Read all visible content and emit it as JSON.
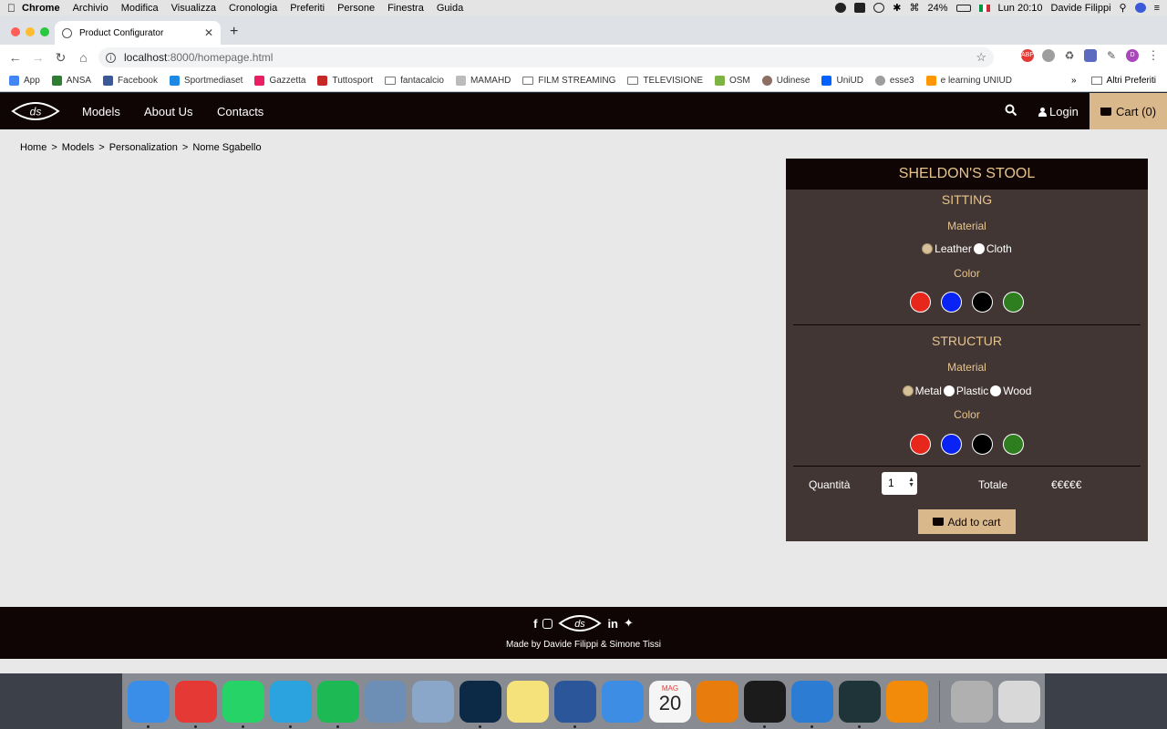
{
  "menubar": {
    "app": "Chrome",
    "items": [
      "Archivio",
      "Modifica",
      "Visualizza",
      "Cronologia",
      "Preferiti",
      "Persone",
      "Finestra",
      "Guida"
    ],
    "battery": "24%",
    "clock": "Lun 20:10",
    "user": "Davide Filippi"
  },
  "browser": {
    "tab_title": "Product Configurator",
    "url_host": "localhost",
    "url_path": ":8000/homepage.html",
    "bookmarks": [
      {
        "label": "App",
        "icon": "apps-grid-icon",
        "color": "#4285f4"
      },
      {
        "label": "ANSA",
        "icon": "ansa-icon",
        "color": "#2e7d32"
      },
      {
        "label": "Facebook",
        "icon": "facebook-icon",
        "color": "#3b5998"
      },
      {
        "label": "Sportmediaset",
        "icon": "sportmediaset-icon",
        "color": "#1e88e5"
      },
      {
        "label": "Gazzetta",
        "icon": "gazzetta-icon",
        "color": "#e91e63"
      },
      {
        "label": "Tuttosport",
        "icon": "tuttosport-icon",
        "color": "#c62828"
      },
      {
        "label": "fantacalcio",
        "icon": "folder-icon",
        "color": ""
      },
      {
        "label": "MAMAHD",
        "icon": "mamahd-icon",
        "color": "#bbbbbb"
      },
      {
        "label": "FILM STREAMING",
        "icon": "folder-icon",
        "color": ""
      },
      {
        "label": "TELEVISIONE",
        "icon": "folder-icon",
        "color": ""
      },
      {
        "label": "OSM",
        "icon": "osm-icon",
        "color": "#7cb342"
      },
      {
        "label": "Udinese",
        "icon": "udinese-icon",
        "color": "#8d6e63"
      },
      {
        "label": "UniUD",
        "icon": "dropbox-icon",
        "color": "#0061ff"
      },
      {
        "label": "esse3",
        "icon": "esse3-icon",
        "color": "#9e9e9e"
      },
      {
        "label": "e learning UNIUD",
        "icon": "elearning-icon",
        "color": "#ff9800"
      }
    ],
    "more_bookmarks": "»",
    "other_bookmarks": "Altri Preferiti"
  },
  "site": {
    "logo_text": "ds",
    "nav": [
      "Models",
      "About Us",
      "Contacts"
    ],
    "login": "Login",
    "cart": "Cart (0)"
  },
  "breadcrumb": [
    "Home",
    "Models",
    "Personalization",
    "Nome Sgabello"
  ],
  "configurator": {
    "title": "SHELDON'S STOOL",
    "sitting": {
      "title": "SITTING",
      "material_label": "Material",
      "materials": [
        "Leather",
        "Cloth"
      ],
      "selected_material": "Leather",
      "color_label": "Color",
      "colors": [
        "#e8271c",
        "#0a23f5",
        "#000000",
        "#2e7d1f"
      ]
    },
    "structure": {
      "title": "STRUCTUR",
      "material_label": "Material",
      "materials": [
        "Metal",
        "Plastic",
        "Wood"
      ],
      "selected_material": "Metal",
      "color_label": "Color",
      "colors": [
        "#e8271c",
        "#0a23f5",
        "#000000",
        "#2e7d1f"
      ]
    },
    "quantity_label": "Quantità",
    "quantity_value": "1",
    "total_label": "Totale",
    "total_value": "€€€€€",
    "add_to_cart": "Add to cart"
  },
  "footer": {
    "credits": "Made by Davide Filippi & Simone Tissi",
    "logo_text": "ds"
  },
  "dock": {
    "apps": [
      {
        "icon": "finder-icon",
        "color": "#3b8ee8"
      },
      {
        "icon": "chrome-icon",
        "color": "#e53935"
      },
      {
        "icon": "whatsapp-icon",
        "color": "#25d366"
      },
      {
        "icon": "telegram-icon",
        "color": "#2aa3df"
      },
      {
        "icon": "spotify-icon",
        "color": "#1db954"
      },
      {
        "icon": "mail-icon",
        "color": "#6d8fb5"
      },
      {
        "icon": "preview-icon",
        "color": "#8aa6c9"
      },
      {
        "icon": "photoshop-icon",
        "color": "#0c2945"
      },
      {
        "icon": "notes-icon",
        "color": "#f6e27a"
      },
      {
        "icon": "word-icon",
        "color": "#2b579a"
      },
      {
        "icon": "keynote-icon",
        "color": "#3c8de3"
      },
      {
        "icon": "calendar-icon",
        "color": "#f5f5f5"
      },
      {
        "icon": "blender-icon",
        "color": "#e87d0d"
      },
      {
        "icon": "terminal-icon",
        "color": "#1b1b1b"
      },
      {
        "icon": "vscode-icon",
        "color": "#2c7cd3"
      },
      {
        "icon": "gitkraken-icon",
        "color": "#1e3438"
      },
      {
        "icon": "vlc-icon",
        "color": "#f28a0a"
      },
      {
        "icon": "photo-booth-icon",
        "color": "#b0b0b0"
      },
      {
        "icon": "trash-icon",
        "color": "#d8d8d8"
      }
    ],
    "calendar_month": "MAG",
    "calendar_day": "20"
  }
}
